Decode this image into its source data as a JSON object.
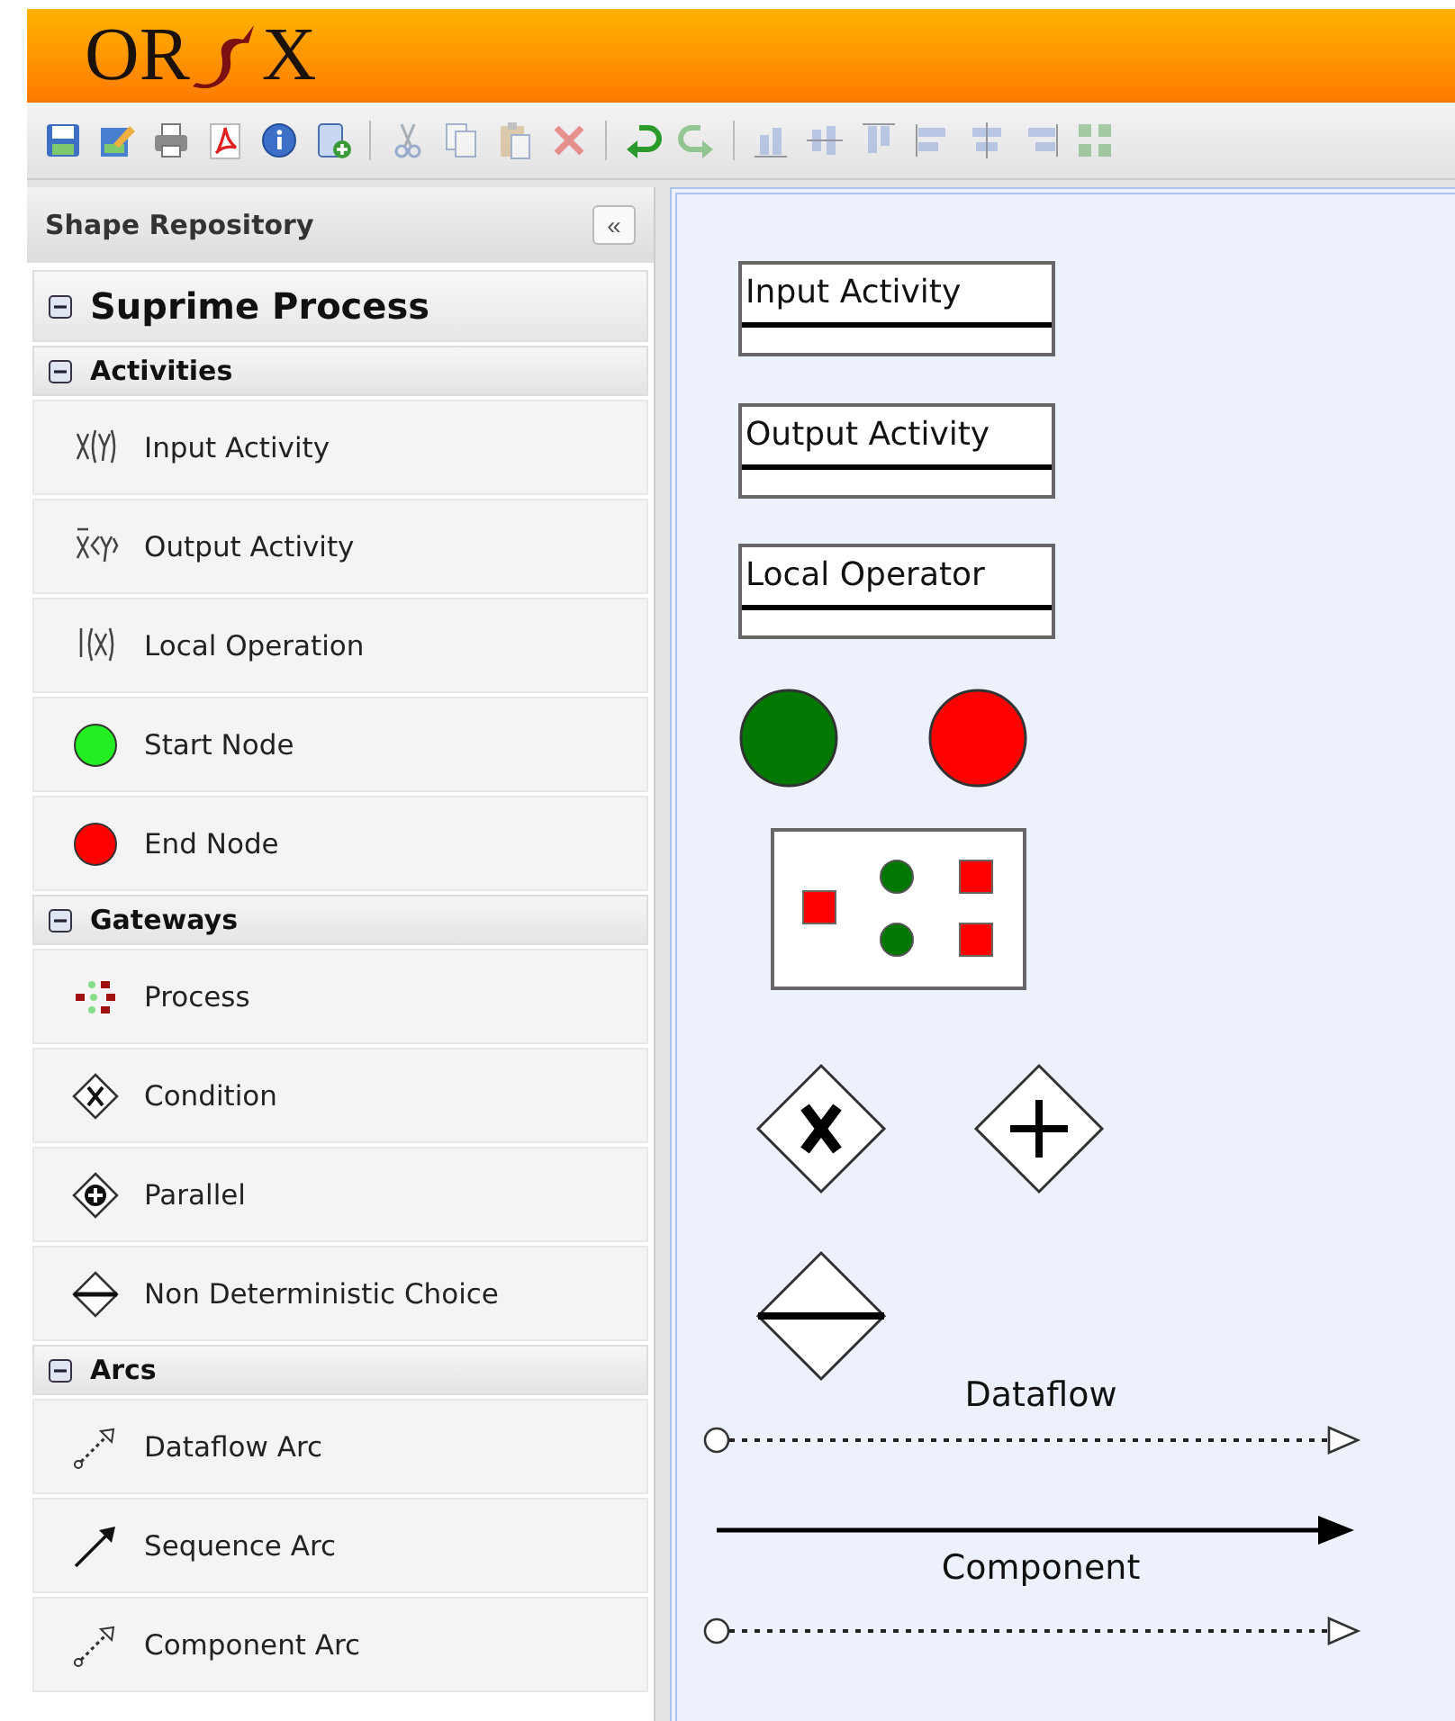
{
  "logo": {
    "left": "OR",
    "right": "X"
  },
  "toolbar": [
    {
      "kind": "save",
      "disabled": false
    },
    {
      "kind": "edit",
      "disabled": false
    },
    {
      "kind": "print",
      "disabled": false
    },
    {
      "kind": "pdf",
      "disabled": false
    },
    {
      "kind": "info",
      "disabled": false
    },
    {
      "kind": "import",
      "disabled": false
    },
    {
      "kind": "sep"
    },
    {
      "kind": "cut",
      "disabled": true
    },
    {
      "kind": "copy",
      "disabled": true
    },
    {
      "kind": "paste",
      "disabled": true
    },
    {
      "kind": "delete",
      "disabled": true
    },
    {
      "kind": "sep"
    },
    {
      "kind": "undo",
      "disabled": false
    },
    {
      "kind": "redo",
      "disabled": true
    },
    {
      "kind": "sep"
    },
    {
      "kind": "align-bottom",
      "disabled": true
    },
    {
      "kind": "align-middle",
      "disabled": true
    },
    {
      "kind": "align-top",
      "disabled": true
    },
    {
      "kind": "align-left",
      "disabled": true
    },
    {
      "kind": "align-center",
      "disabled": true
    },
    {
      "kind": "align-right",
      "disabled": true
    },
    {
      "kind": "grid",
      "disabled": true
    }
  ],
  "sidebar": {
    "title": "Shape Repository",
    "collapse": "«",
    "stencil": {
      "title": "Suprime Process",
      "expanded": true,
      "groups": [
        {
          "title": "Activities",
          "expanded": true,
          "items": [
            {
              "label": "Input Activity",
              "kind": "input"
            },
            {
              "label": "Output Activity",
              "kind": "output"
            },
            {
              "label": "Local Operation",
              "kind": "local"
            },
            {
              "label": "Start Node",
              "kind": "start"
            },
            {
              "label": "End Node",
              "kind": "end"
            }
          ]
        },
        {
          "title": "Gateways",
          "expanded": true,
          "items": [
            {
              "label": "Process",
              "kind": "process"
            },
            {
              "label": "Condition",
              "kind": "condition"
            },
            {
              "label": "Parallel",
              "kind": "parallel"
            },
            {
              "label": "Non Deterministic Choice",
              "kind": "choice"
            }
          ]
        },
        {
          "title": "Arcs",
          "expanded": true,
          "items": [
            {
              "label": "Dataflow Arc",
              "kind": "dataflow"
            },
            {
              "label": "Sequence Arc",
              "kind": "sequence"
            },
            {
              "label": "Component Arc",
              "kind": "component"
            }
          ]
        }
      ]
    }
  },
  "canvas": {
    "nodes": [
      {
        "kind": "activity",
        "label": "Input Activity"
      },
      {
        "kind": "activity",
        "label": "Output Activity"
      },
      {
        "kind": "activity",
        "label": "Local Operator"
      },
      {
        "kind": "start"
      },
      {
        "kind": "end"
      },
      {
        "kind": "process"
      },
      {
        "kind": "condition"
      },
      {
        "kind": "parallel"
      },
      {
        "kind": "choice"
      },
      {
        "kind": "dataflow",
        "label": "Dataflow"
      },
      {
        "kind": "sequence"
      },
      {
        "kind": "component",
        "label": "Component"
      }
    ]
  }
}
